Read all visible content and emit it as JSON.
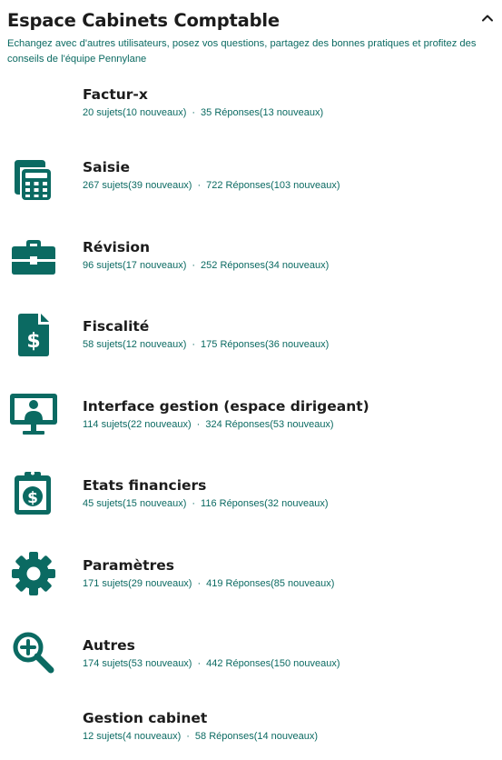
{
  "header": {
    "title": "Espace Cabinets Comptable",
    "description": "Echangez avec d'autres utilisateurs, posez vos questions, partagez des bonnes pratiques et profitez des conseils de l'équipe Pennylane"
  },
  "colors": {
    "accent": "#0b6a62",
    "title": "#1c1c1c"
  },
  "categories": [
    {
      "name": "Factur-x",
      "icon": "none",
      "subjects": "20 sujets(10 nouveaux)",
      "responses": "35 Réponses(13 nouveaux)"
    },
    {
      "name": "Saisie",
      "icon": "calculator-icon",
      "subjects": "267 sujets(39 nouveaux)",
      "responses": "722 Réponses(103 nouveaux)"
    },
    {
      "name": "Révision",
      "icon": "briefcase-icon",
      "subjects": "96 sujets(17 nouveaux)",
      "responses": "252 Réponses(34 nouveaux)"
    },
    {
      "name": "Fiscalité",
      "icon": "dollar-document-icon",
      "subjects": "58 sujets(12 nouveaux)",
      "responses": "175 Réponses(36 nouveaux)"
    },
    {
      "name": "Interface gestion (espace dirigeant)",
      "icon": "monitor-user-icon",
      "subjects": "114 sujets(22 nouveaux)",
      "responses": "324 Réponses(53 nouveaux)"
    },
    {
      "name": "Etats financiers",
      "icon": "clipboard-dollar-icon",
      "subjects": "45 sujets(15 nouveaux)",
      "responses": "116 Réponses(32 nouveaux)"
    },
    {
      "name": "Paramètres",
      "icon": "gear-icon",
      "subjects": "171 sujets(29 nouveaux)",
      "responses": "419 Réponses(85 nouveaux)"
    },
    {
      "name": "Autres",
      "icon": "zoom-in-icon",
      "subjects": "174 sujets(53 nouveaux)",
      "responses": "442 Réponses(150 nouveaux)"
    },
    {
      "name": "Gestion cabinet",
      "icon": "none",
      "subjects": "12 sujets(4 nouveaux)",
      "responses": "58 Réponses(14 nouveaux)"
    }
  ],
  "separator": "·"
}
